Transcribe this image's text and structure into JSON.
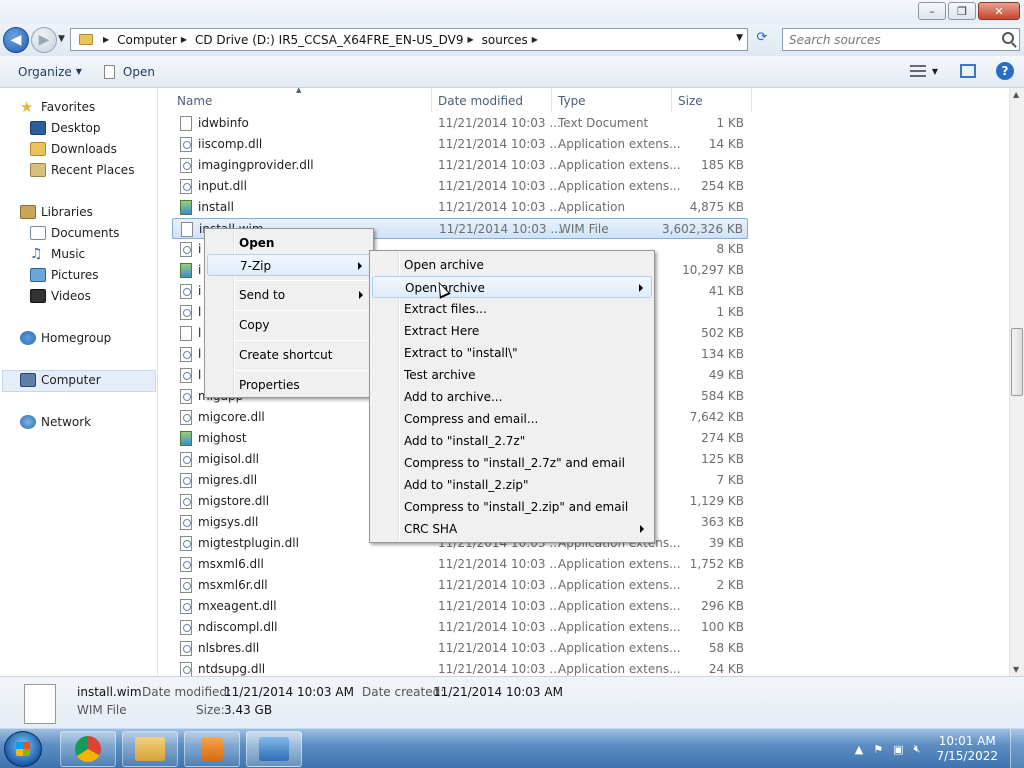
{
  "window": {
    "minimize_glyph": "–",
    "maximize_glyph": "❐",
    "close_glyph": "✕"
  },
  "address": {
    "crumbs": [
      "Computer",
      "CD Drive (D:) IR5_CCSA_X64FRE_EN-US_DV9",
      "sources"
    ],
    "search_placeholder": "Search sources"
  },
  "toolbar": {
    "organize_label": "Organize",
    "open_label": "Open"
  },
  "nav": {
    "favorites": "Favorites",
    "desktop": "Desktop",
    "downloads": "Downloads",
    "recent_places": "Recent Places",
    "libraries": "Libraries",
    "documents": "Documents",
    "music": "Music",
    "pictures": "Pictures",
    "videos": "Videos",
    "homegroup": "Homegroup",
    "computer": "Computer",
    "network": "Network"
  },
  "columns": {
    "name": "Name",
    "date": "Date modified",
    "type": "Type",
    "size": "Size"
  },
  "files": [
    {
      "name": "idwbinfo",
      "date": "11/21/2014 10:03 ...",
      "type": "Text Document",
      "size": "1 KB",
      "icon": "txt"
    },
    {
      "name": "iiscomp.dll",
      "date": "11/21/2014 10:03 ...",
      "type": "Application extens...",
      "size": "14 KB",
      "icon": "dll"
    },
    {
      "name": "imagingprovider.dll",
      "date": "11/21/2014 10:03 ...",
      "type": "Application extens...",
      "size": "185 KB",
      "icon": "dll"
    },
    {
      "name": "input.dll",
      "date": "11/21/2014 10:03 ...",
      "type": "Application extens...",
      "size": "254 KB",
      "icon": "dll"
    },
    {
      "name": "install",
      "date": "11/21/2014 10:03 ...",
      "type": "Application",
      "size": "4,875 KB",
      "icon": "app"
    },
    {
      "name": "install.wim",
      "date": "11/21/2014 10:03 ...",
      "type": "WIM File",
      "size": "3,602,326 KB",
      "icon": "txt",
      "selected": true
    },
    {
      "name": "i",
      "date": "",
      "type": "",
      "size": "8 KB",
      "icon": "dll"
    },
    {
      "name": "i",
      "date": "",
      "type": "",
      "size": "10,297 KB",
      "icon": "app"
    },
    {
      "name": "i",
      "date": "",
      "type": "",
      "size": "41 KB",
      "icon": "dll"
    },
    {
      "name": "l",
      "date": "",
      "type": "",
      "size": "1 KB",
      "icon": "dll"
    },
    {
      "name": "l",
      "date": "",
      "type": "",
      "size": "502 KB",
      "icon": "txt"
    },
    {
      "name": "l",
      "date": "",
      "type": "",
      "size": "134 KB",
      "icon": "dll"
    },
    {
      "name": "l",
      "date": "",
      "type": "",
      "size": "49 KB",
      "icon": "dll"
    },
    {
      "name": "migapp",
      "date": "",
      "type": "",
      "size": "584 KB",
      "icon": "dll"
    },
    {
      "name": "migcore.dll",
      "date": "",
      "type": "",
      "size": "7,642 KB",
      "icon": "dll"
    },
    {
      "name": "mighost",
      "date": "",
      "type": "",
      "size": "274 KB",
      "icon": "app"
    },
    {
      "name": "migisol.dll",
      "date": "",
      "type": "",
      "size": "125 KB",
      "icon": "dll"
    },
    {
      "name": "migres.dll",
      "date": "",
      "type": "",
      "size": "7 KB",
      "icon": "dll"
    },
    {
      "name": "migstore.dll",
      "date": "",
      "type": "",
      "size": "1,129 KB",
      "icon": "dll"
    },
    {
      "name": "migsys.dll",
      "date": "",
      "type": "",
      "size": "363 KB",
      "icon": "dll"
    },
    {
      "name": "migtestplugin.dll",
      "date": "11/21/2014 10:03 ...",
      "type": "Application extens...",
      "size": "39 KB",
      "icon": "dll"
    },
    {
      "name": "msxml6.dll",
      "date": "11/21/2014 10:03 ...",
      "type": "Application extens...",
      "size": "1,752 KB",
      "icon": "dll"
    },
    {
      "name": "msxml6r.dll",
      "date": "11/21/2014 10:03 ...",
      "type": "Application extens...",
      "size": "2 KB",
      "icon": "dll"
    },
    {
      "name": "mxeagent.dll",
      "date": "11/21/2014 10:03 ...",
      "type": "Application extens...",
      "size": "296 KB",
      "icon": "dll"
    },
    {
      "name": "ndiscompl.dll",
      "date": "11/21/2014 10:03 ...",
      "type": "Application extens...",
      "size": "100 KB",
      "icon": "dll"
    },
    {
      "name": "nlsbres.dll",
      "date": "11/21/2014 10:03 ...",
      "type": "Application extens...",
      "size": "58 KB",
      "icon": "dll"
    },
    {
      "name": "ntdsupg.dll",
      "date": "11/21/2014 10:03 ...",
      "type": "Application extens...",
      "size": "24 KB",
      "icon": "dll"
    }
  ],
  "context_menu": {
    "items": [
      "Open",
      "7-Zip",
      "Send to",
      "Copy",
      "Create shortcut",
      "Properties"
    ]
  },
  "zip_menu": {
    "items": [
      "Open archive",
      "Open archive",
      "Extract files...",
      "Extract Here",
      "Extract to \"install\\\"",
      "Test archive",
      "Add to archive...",
      "Compress and email...",
      "Add to \"install_2.7z\"",
      "Compress to \"install_2.7z\" and email",
      "Add to \"install_2.zip\"",
      "Compress to \"install_2.zip\" and email",
      "CRC SHA"
    ]
  },
  "details": {
    "filename": "install.wim",
    "filetype": "WIM File",
    "date_modified_label": "Date modified:",
    "date_modified": "11/21/2014 10:03 AM",
    "date_created_label": "Date created:",
    "date_created": "11/21/2014 10:03 AM",
    "size_label": "Size:",
    "size": "3.43 GB"
  },
  "taskbar": {
    "time": "10:01 AM",
    "date": "7/15/2022"
  },
  "colors": {
    "selection": "#cfe3f7",
    "accent": "#2b6cc4"
  }
}
